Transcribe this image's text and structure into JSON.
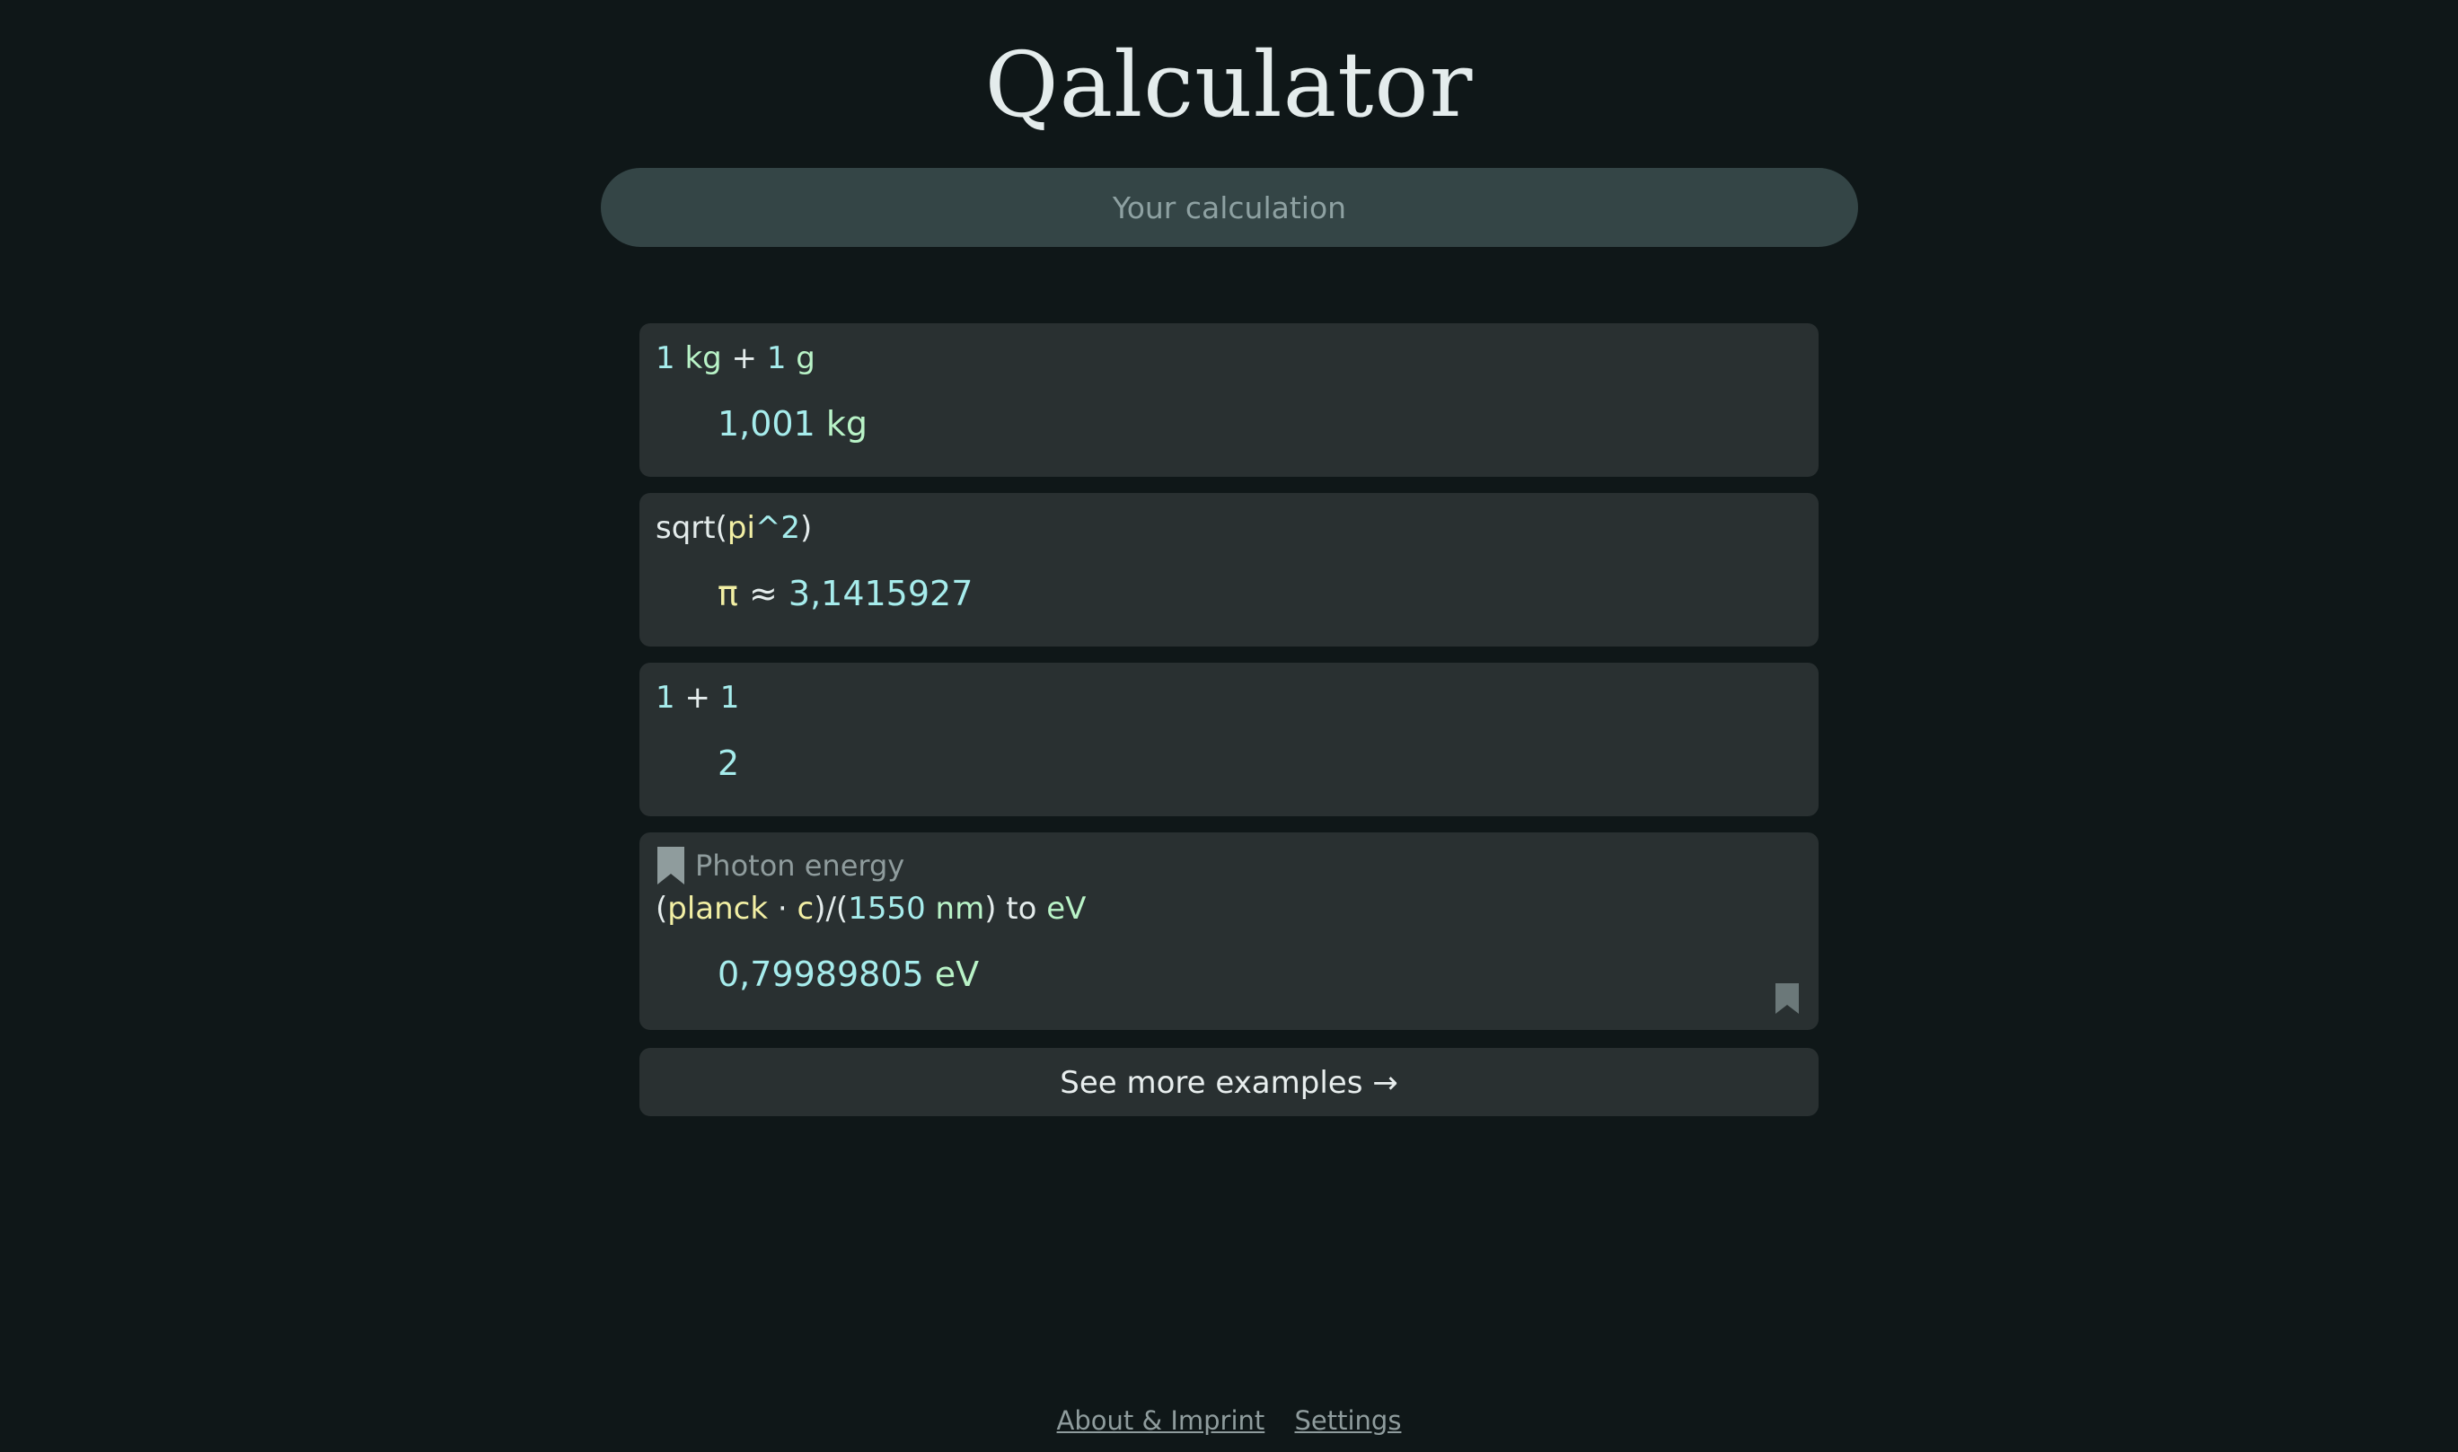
{
  "app": {
    "title": "Qalculator"
  },
  "search": {
    "placeholder": "Your calculation",
    "value": ""
  },
  "examples": [
    {
      "expression": [
        {
          "text": "1",
          "kind": "num"
        },
        {
          "text": " ",
          "kind": "op"
        },
        {
          "text": "kg",
          "kind": "unit"
        },
        {
          "text": " + ",
          "kind": "op"
        },
        {
          "text": "1",
          "kind": "num"
        },
        {
          "text": " ",
          "kind": "op"
        },
        {
          "text": "g",
          "kind": "unit"
        }
      ],
      "result": [
        {
          "text": "1,001",
          "kind": "num"
        },
        {
          "text": " ",
          "kind": "op"
        },
        {
          "text": "kg",
          "kind": "unit"
        }
      ]
    },
    {
      "expression": [
        {
          "text": "sqrt(",
          "kind": "fn"
        },
        {
          "text": "pi",
          "kind": "const"
        },
        {
          "text": "^2",
          "kind": "num"
        },
        {
          "text": ")",
          "kind": "fn"
        }
      ],
      "result": [
        {
          "text": "π",
          "kind": "const"
        },
        {
          "text": " ≈ ",
          "kind": "op"
        },
        {
          "text": "3,1415927",
          "kind": "num"
        }
      ]
    },
    {
      "expression": [
        {
          "text": "1",
          "kind": "num"
        },
        {
          "text": " + ",
          "kind": "op"
        },
        {
          "text": "1",
          "kind": "num"
        }
      ],
      "result": [
        {
          "text": "2",
          "kind": "num"
        }
      ]
    },
    {
      "bookmark_label": "Photon energy",
      "expression": [
        {
          "text": "(",
          "kind": "op"
        },
        {
          "text": "planck",
          "kind": "const"
        },
        {
          "text": " · ",
          "kind": "op"
        },
        {
          "text": "c",
          "kind": "const"
        },
        {
          "text": ")∕(",
          "kind": "op"
        },
        {
          "text": "1550",
          "kind": "num"
        },
        {
          "text": " ",
          "kind": "op"
        },
        {
          "text": "nm",
          "kind": "unit"
        },
        {
          "text": ") ",
          "kind": "op"
        },
        {
          "text": "to",
          "kind": "kw"
        },
        {
          "text": " ",
          "kind": "op"
        },
        {
          "text": "eV",
          "kind": "unit"
        }
      ],
      "result": [
        {
          "text": "0,79989805",
          "kind": "num"
        },
        {
          "text": " ",
          "kind": "op"
        },
        {
          "text": "eV",
          "kind": "unit"
        }
      ]
    }
  ],
  "more_examples_label": "See more examples →",
  "footer": {
    "about_label": "About & Imprint",
    "settings_label": "Settings"
  },
  "colors": {
    "background": "#0f1718",
    "card": "#293031",
    "search": "#344546",
    "number": "#a6ecec",
    "unit": "#b9f3c7",
    "constant": "#f2efa4",
    "muted": "#8f9c9d"
  },
  "icons": {
    "bookmark_label_icon": "bookmark-icon",
    "bookmark_corner_icon": "bookmark-icon"
  }
}
